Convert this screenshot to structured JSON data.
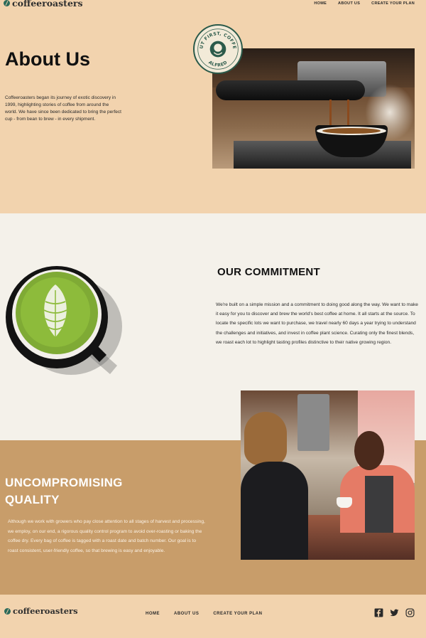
{
  "brand": {
    "name": "coffeeroasters"
  },
  "nav": {
    "home": "HOME",
    "about": "ABOUT US",
    "plan": "CREATE YOUR PLAN"
  },
  "about": {
    "title": "About Us",
    "text": "Coffeeroasters began its journey of exotic discovery in 1999, highlighting stories of coffee from around the world. We have since been dedicated to bring the perfect cup - from bean to brew - in every shipment."
  },
  "badge": {
    "top_text": "BUT FIRST, COFFEE",
    "bottom_text": "ALFRED"
  },
  "commitment": {
    "title": "OUR COMMITMENT",
    "text": "We're built on a simple mission and a commitment to doing good along the way. We want to make it easy for you to discover and brew the world's best coffee at home. It all starts at the source. To locate the specific lots we want to purchase, we travel nearly 60 days a year trying to understand the challenges and initiatives, and invest in coffee plant science. Curating only the finest blends, we roast each lot to highlight tasting profiles distinctive to their native growing region."
  },
  "quality": {
    "title_line1": "UNCOMPROMISING",
    "title_line2": "QUALITY",
    "text": "Although we work with growers who pay close attention to all stages of harvest and processing, we employ, on our end, a rigorous quality control program to avoid over-roasting or baking the coffee dry. Every bag of coffee is tagged with a roast date and batch number. Our goal is to roast consistent, user-friendly coffee, so that brewing is easy and enjoyable."
  },
  "footer": {
    "nav": {
      "home": "HOME",
      "about": "ABOUT US",
      "plan": "CREATE YOUR PLAN"
    },
    "social": [
      "facebook-icon",
      "twitter-icon",
      "instagram-icon"
    ]
  },
  "colors": {
    "peach": "#f2d3ae",
    "cream": "#f4f1ea",
    "tan": "#c89d6a",
    "badge_green": "#2b5a4a"
  }
}
